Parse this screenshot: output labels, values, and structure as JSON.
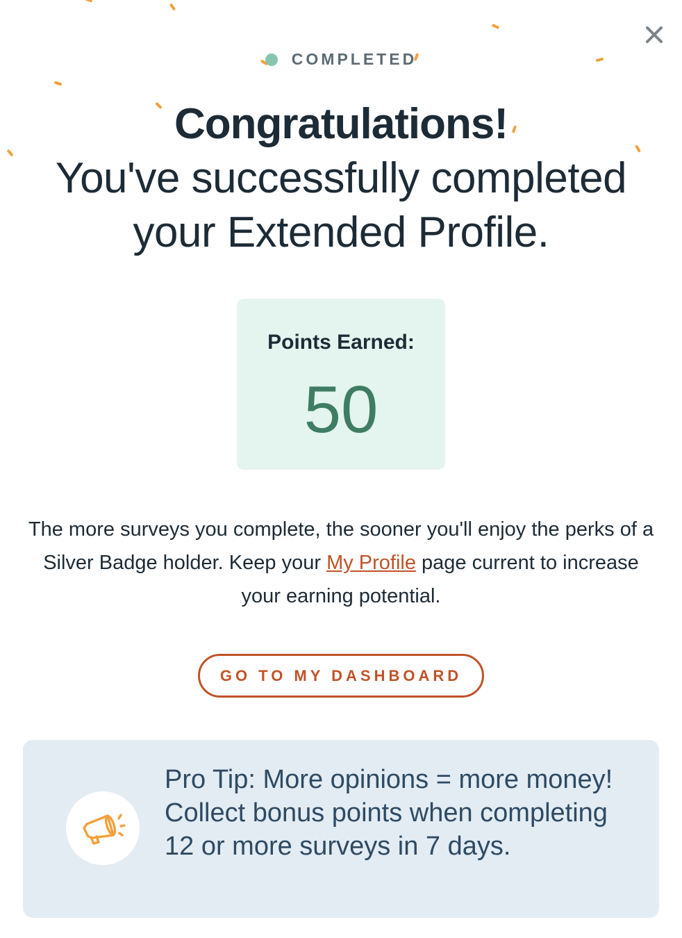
{
  "status": {
    "label": "COMPLETED",
    "dot_color": "#86c6ae"
  },
  "heading": {
    "line1": "Congratulations!",
    "line2": "You've successfully completed",
    "line3": "your Extended Profile."
  },
  "points": {
    "label": "Points Earned:",
    "value": "50"
  },
  "body": {
    "text_before_link": "The more surveys you complete, the sooner you'll enjoy the perks of a Silver Badge holder. Keep your ",
    "link_text": "My Profile",
    "text_after_link": " page current to increase your earning potential."
  },
  "actions": {
    "dashboard_label": "GO TO MY DASHBOARD"
  },
  "tip": {
    "text": "Pro Tip: More opinions = more money! Collect bonus points when completing 12 or more surveys in 7 days.",
    "icon": "megaphone-icon"
  },
  "icons": {
    "close": "close-icon"
  },
  "colors": {
    "accent": "#c05328",
    "points_value": "#3e7d63",
    "points_card_bg": "#e4f4ee",
    "tip_card_bg": "#e3ecf3",
    "confetti": "#f3a03a"
  }
}
